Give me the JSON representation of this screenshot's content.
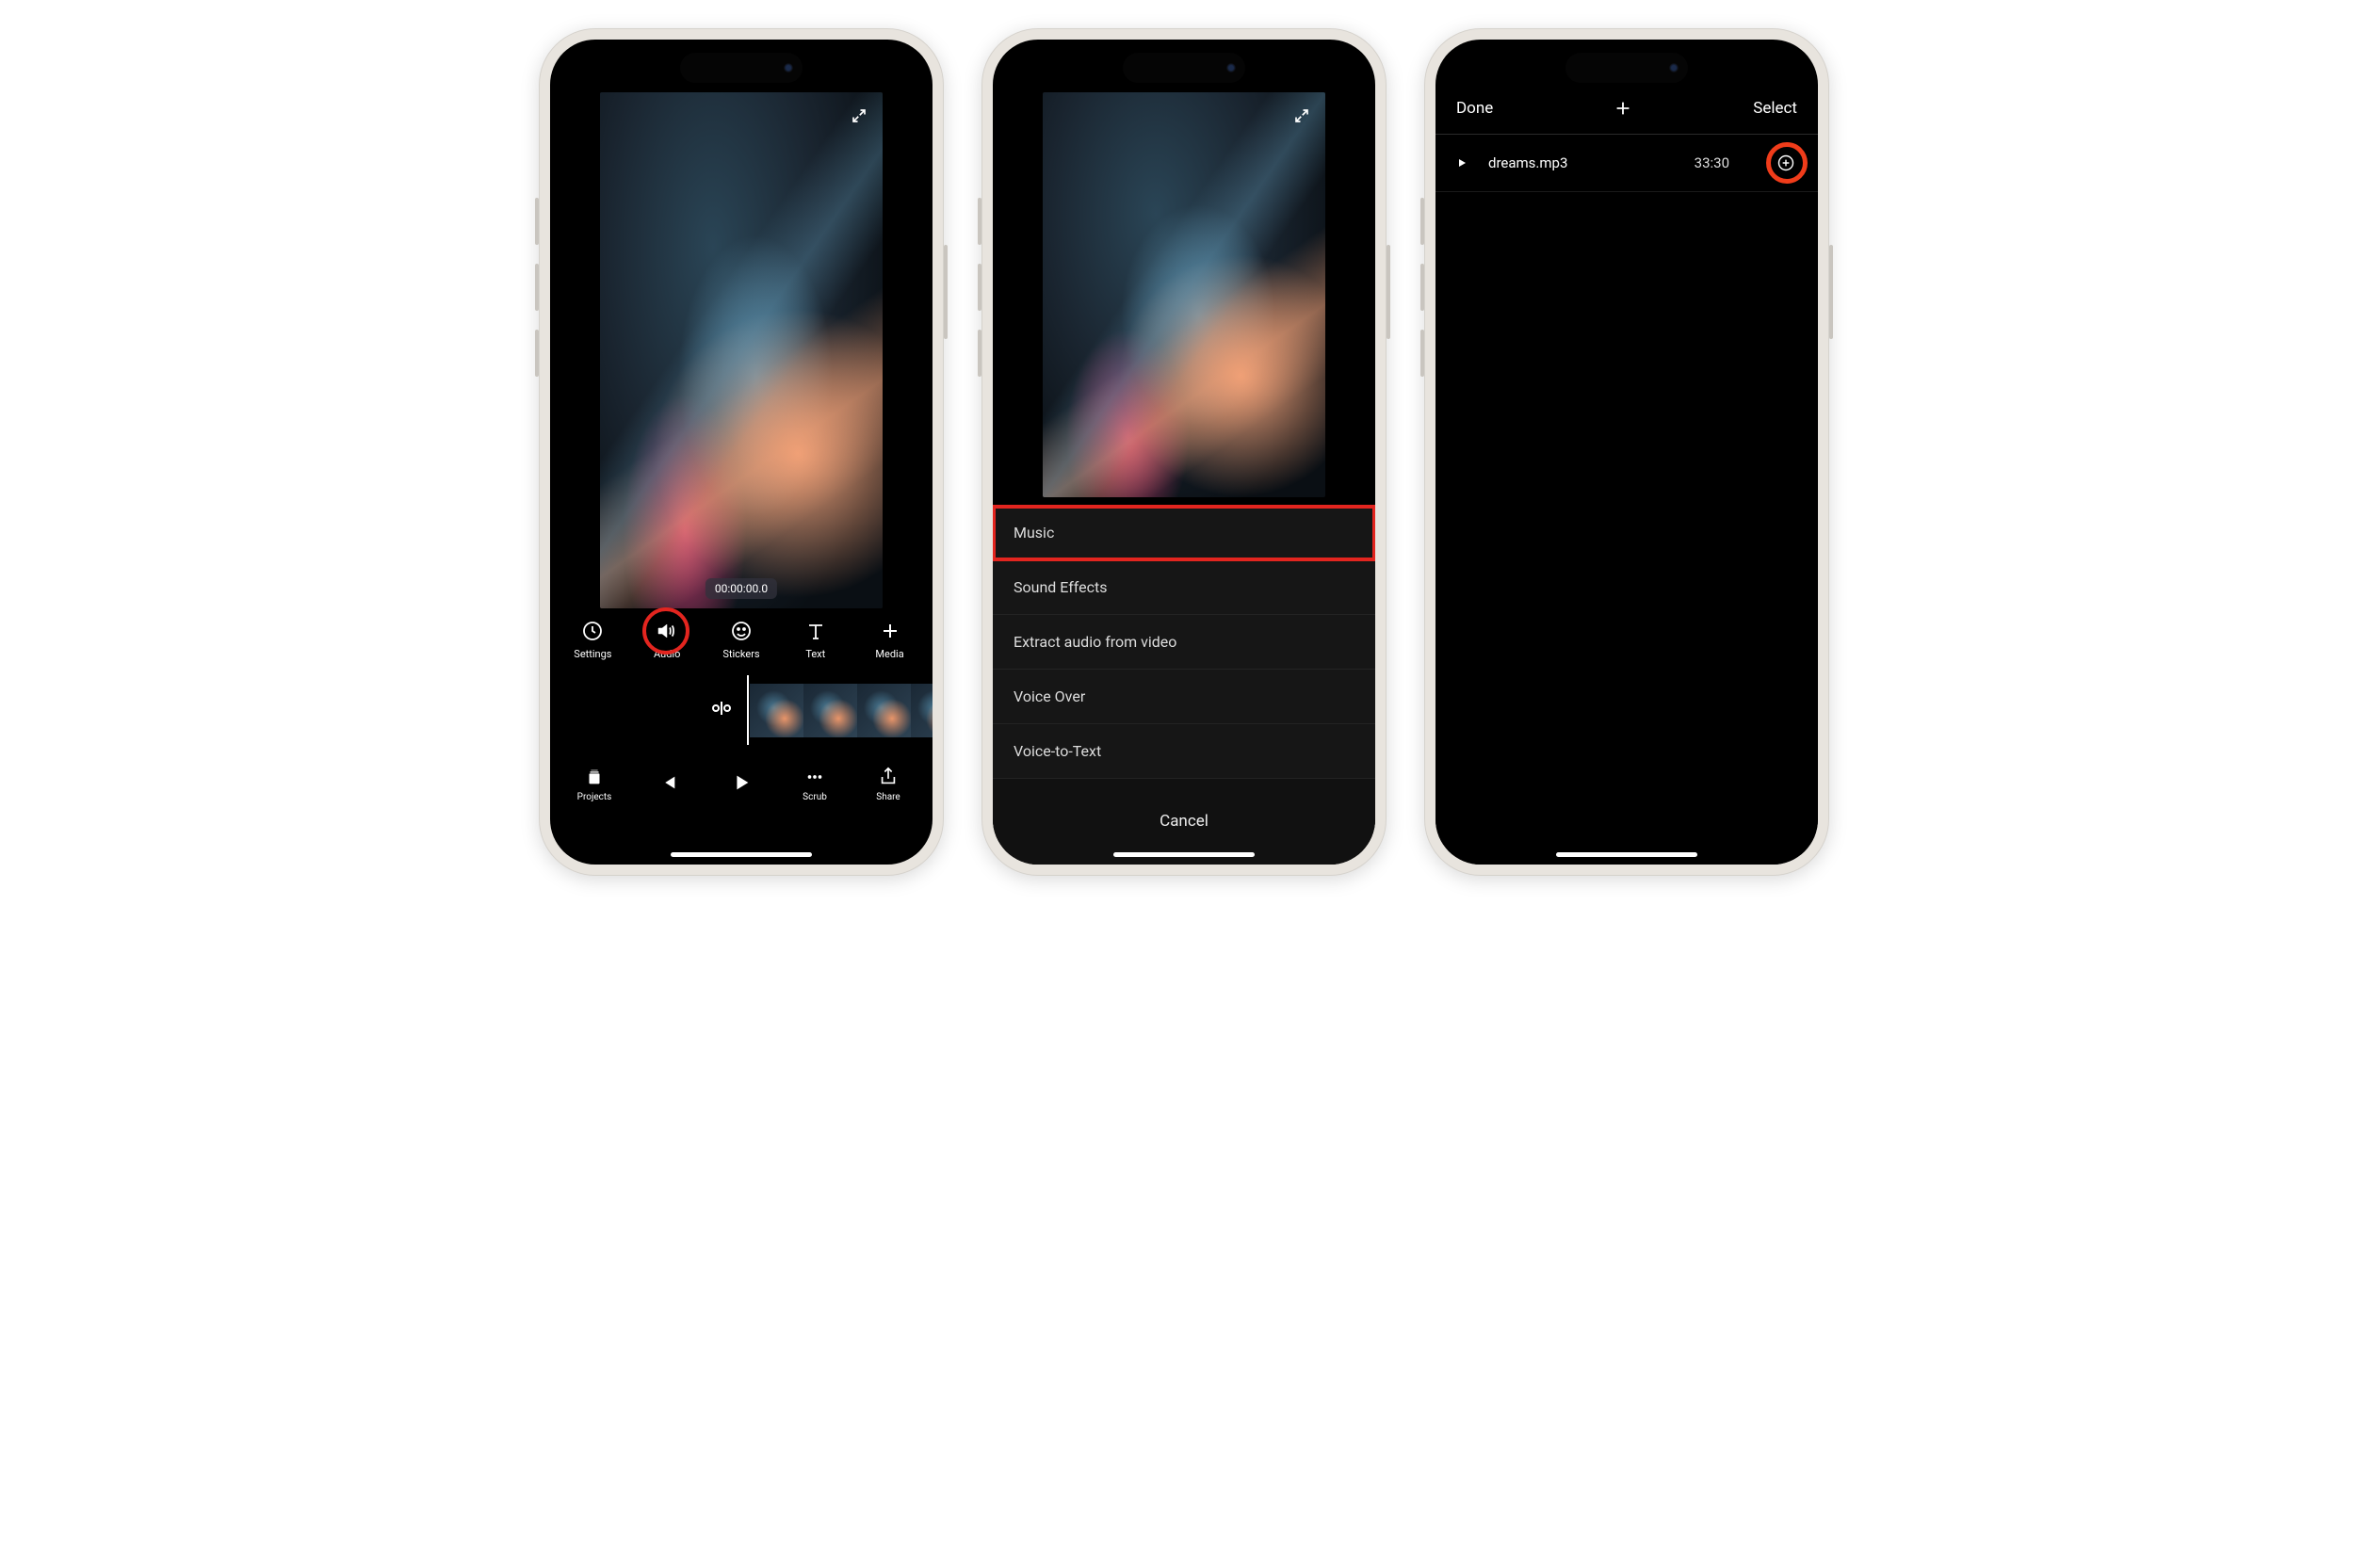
{
  "phone1": {
    "timecode": "00:00:00.0",
    "toolbar": [
      {
        "label": "Settings",
        "name": "settings"
      },
      {
        "label": "Audio",
        "name": "audio"
      },
      {
        "label": "Stickers",
        "name": "stickers"
      },
      {
        "label": "Text",
        "name": "text"
      },
      {
        "label": "Media",
        "name": "media"
      }
    ],
    "bottombar": [
      {
        "label": "Projects",
        "name": "projects"
      },
      {
        "label": "",
        "name": "prev"
      },
      {
        "label": "",
        "name": "play"
      },
      {
        "label": "Scrub",
        "name": "scrub"
      },
      {
        "label": "Share",
        "name": "share"
      }
    ]
  },
  "phone2": {
    "menu": [
      {
        "label": "Music",
        "highlighted": true
      },
      {
        "label": "Sound Effects"
      },
      {
        "label": "Extract audio from video"
      },
      {
        "label": "Voice Over"
      },
      {
        "label": "Voice-to-Text"
      }
    ],
    "cancel": "Cancel"
  },
  "phone3": {
    "header": {
      "done": "Done",
      "select": "Select"
    },
    "track": {
      "filename": "dreams.mp3",
      "duration": "33:30"
    }
  }
}
